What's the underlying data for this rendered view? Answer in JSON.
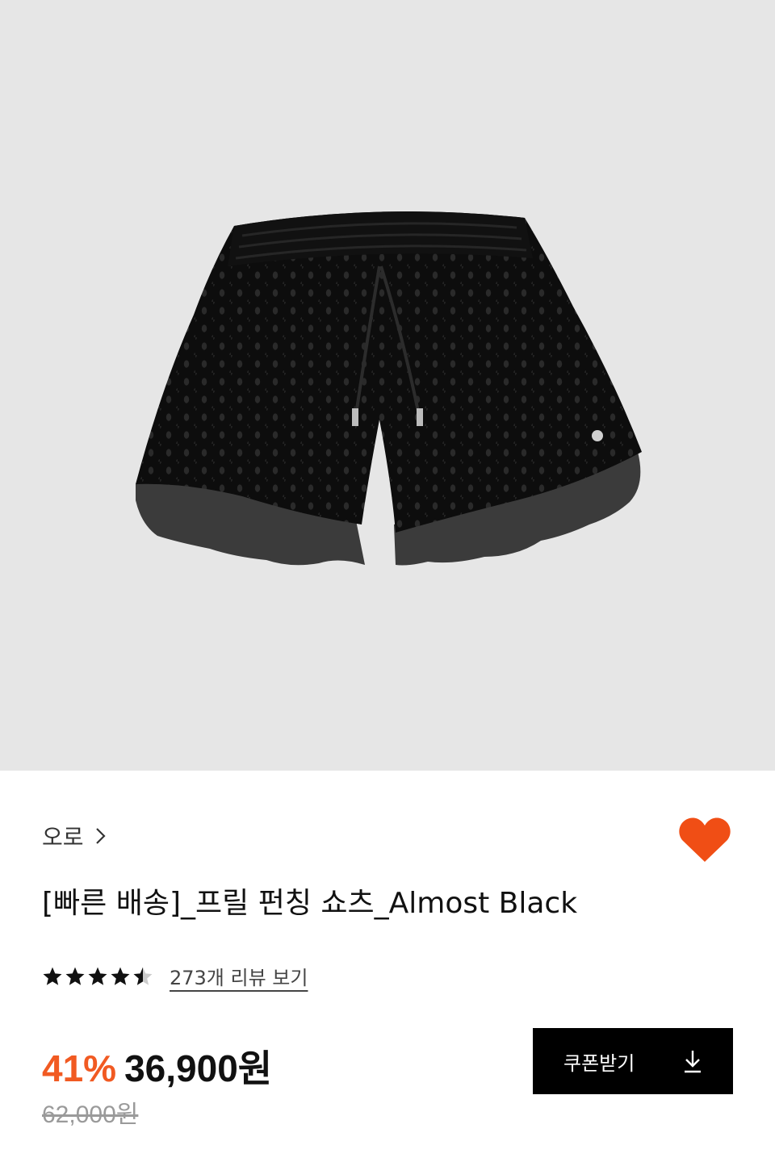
{
  "product": {
    "brand": "오로",
    "title": "[빠른 배송]_프릴 펀칭 쇼츠_Almost Black",
    "rating": 4.5,
    "rating_max": 5,
    "review_link_text": "273개 리뷰 보기",
    "discount_rate": "41%",
    "sale_price": "36,900원",
    "original_price": "62,000원",
    "liked": true
  },
  "actions": {
    "coupon_button_label": "쿠폰받기"
  },
  "icons": {
    "brand_chevron": "chevron-right-icon",
    "wishlist": "heart-icon",
    "rating": "star-icon",
    "coupon_download": "download-icon"
  },
  "colors": {
    "accent": "#f15a22",
    "heart": "#f04e15",
    "button_bg": "#000000",
    "image_bg": "#e6e6e6",
    "muted": "#9a9a9a"
  }
}
